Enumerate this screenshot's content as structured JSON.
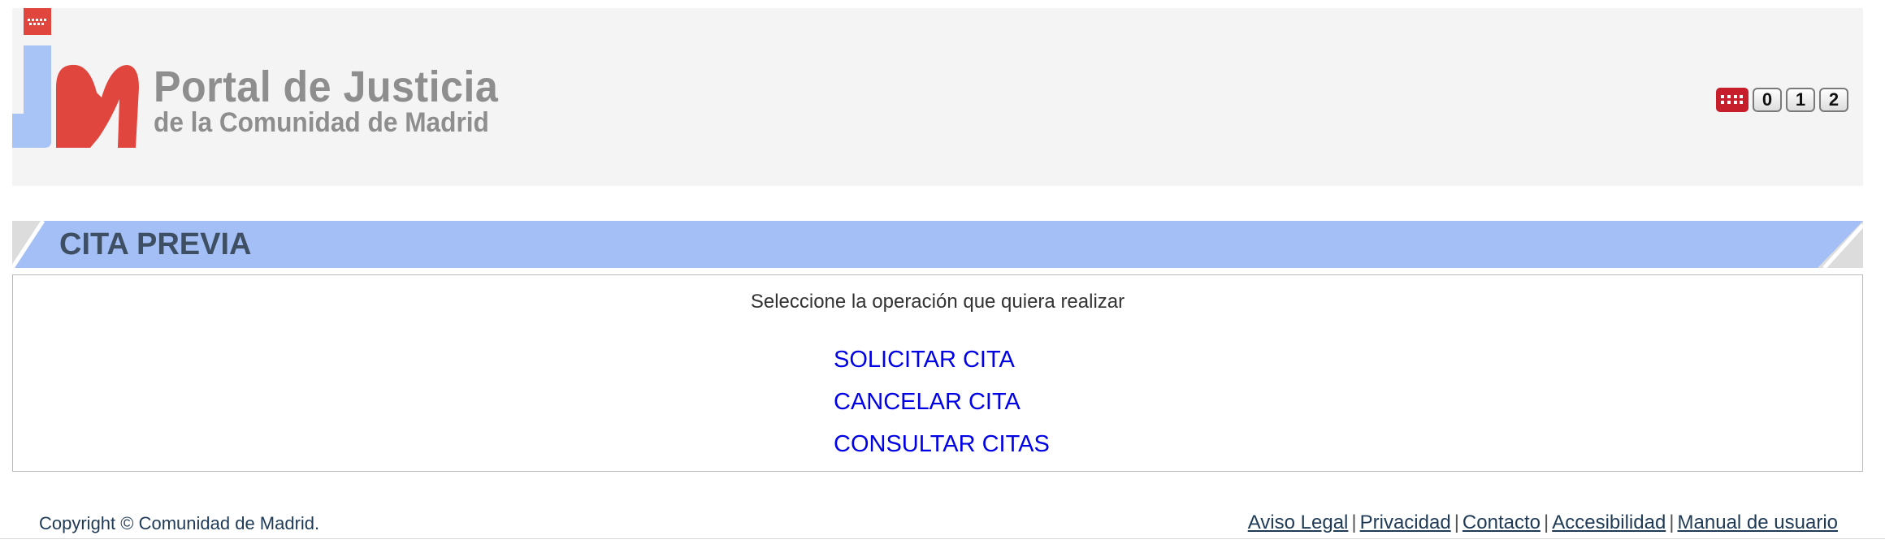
{
  "header": {
    "title": "Portal de Justicia",
    "subtitle": "de la Comunidad de Madrid",
    "badge_digits": [
      "0",
      "1",
      "2"
    ],
    "colors": {
      "logo_blue": "#a8c3f5",
      "logo_red": "#e0463d",
      "flag_red": "#c61e2b",
      "header_bg": "#f4f4f4"
    }
  },
  "section": {
    "title": "CITA PREVIA",
    "bar_color": "#a3bff5"
  },
  "content": {
    "instruction": "Seleccione la operación que quiera realizar",
    "operations": [
      "SOLICITAR CITA",
      "CANCELAR CITA",
      "CONSULTAR CITAS"
    ],
    "link_color": "#0000e6"
  },
  "footer": {
    "copyright": "Copyright © Comunidad de Madrid.",
    "links": [
      "Aviso Legal",
      "Privacidad",
      "Contacto",
      "Accesibilidad",
      "Manual de usuario"
    ],
    "separator": "|"
  }
}
